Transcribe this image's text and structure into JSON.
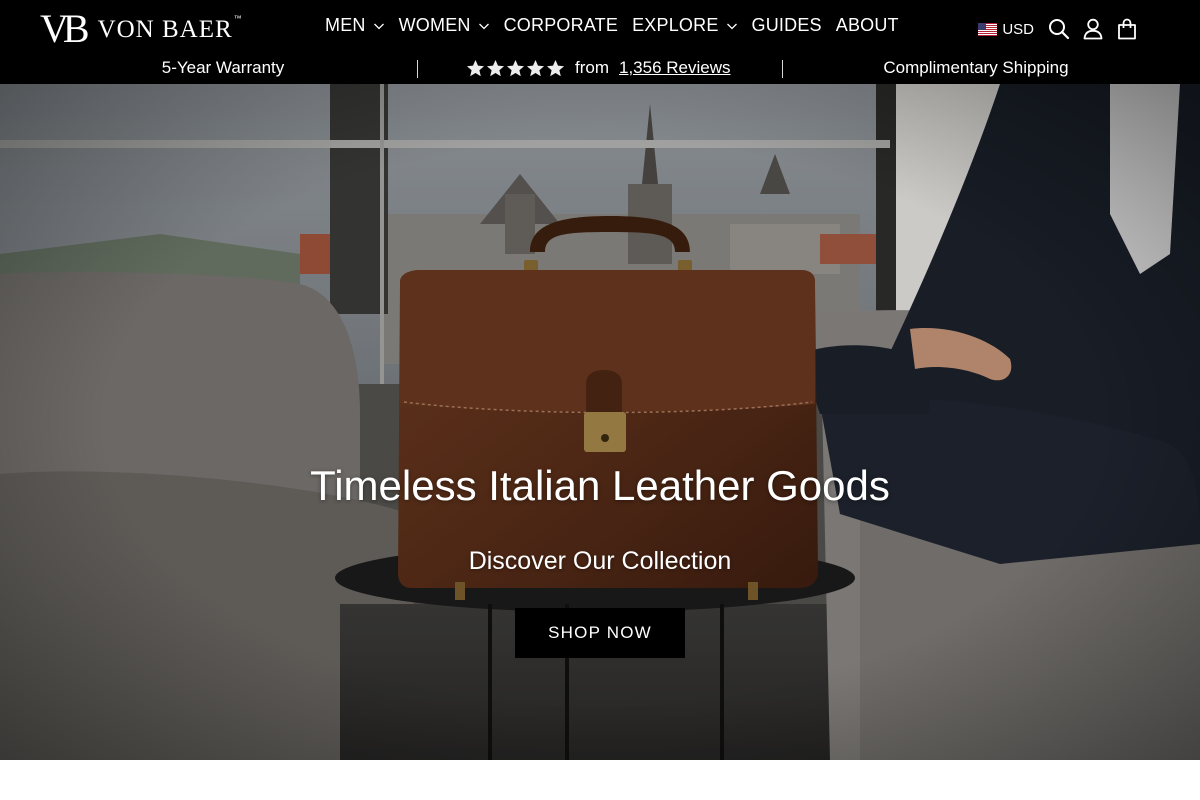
{
  "brand": {
    "mark": "VB",
    "name": "VON BAER",
    "tm": "™"
  },
  "nav": {
    "items": [
      {
        "label": "MEN",
        "dropdown": true
      },
      {
        "label": "WOMEN",
        "dropdown": true
      },
      {
        "label": "CORPORATE",
        "dropdown": false
      },
      {
        "label": "EXPLORE",
        "dropdown": true
      },
      {
        "label": "GUIDES",
        "dropdown": false
      },
      {
        "label": "ABOUT",
        "dropdown": false
      }
    ]
  },
  "utils": {
    "currency": "USD",
    "icons": [
      "us-flag-icon",
      "search-icon",
      "account-icon",
      "cart-icon"
    ]
  },
  "announcement": {
    "warranty": "5-Year Warranty",
    "rating_stars": 5,
    "reviews_prefix": "from",
    "reviews_link": "1,356 Reviews",
    "shipping": "Complimentary Shipping"
  },
  "hero": {
    "title": "Timeless Italian Leather Goods",
    "subtitle": "Discover Our Collection",
    "cta": "SHOP NOW"
  },
  "colors": {
    "header_bg": "#000000",
    "text": "#ffffff",
    "cta_bg": "#000000",
    "page_bg": "#ffffff"
  }
}
